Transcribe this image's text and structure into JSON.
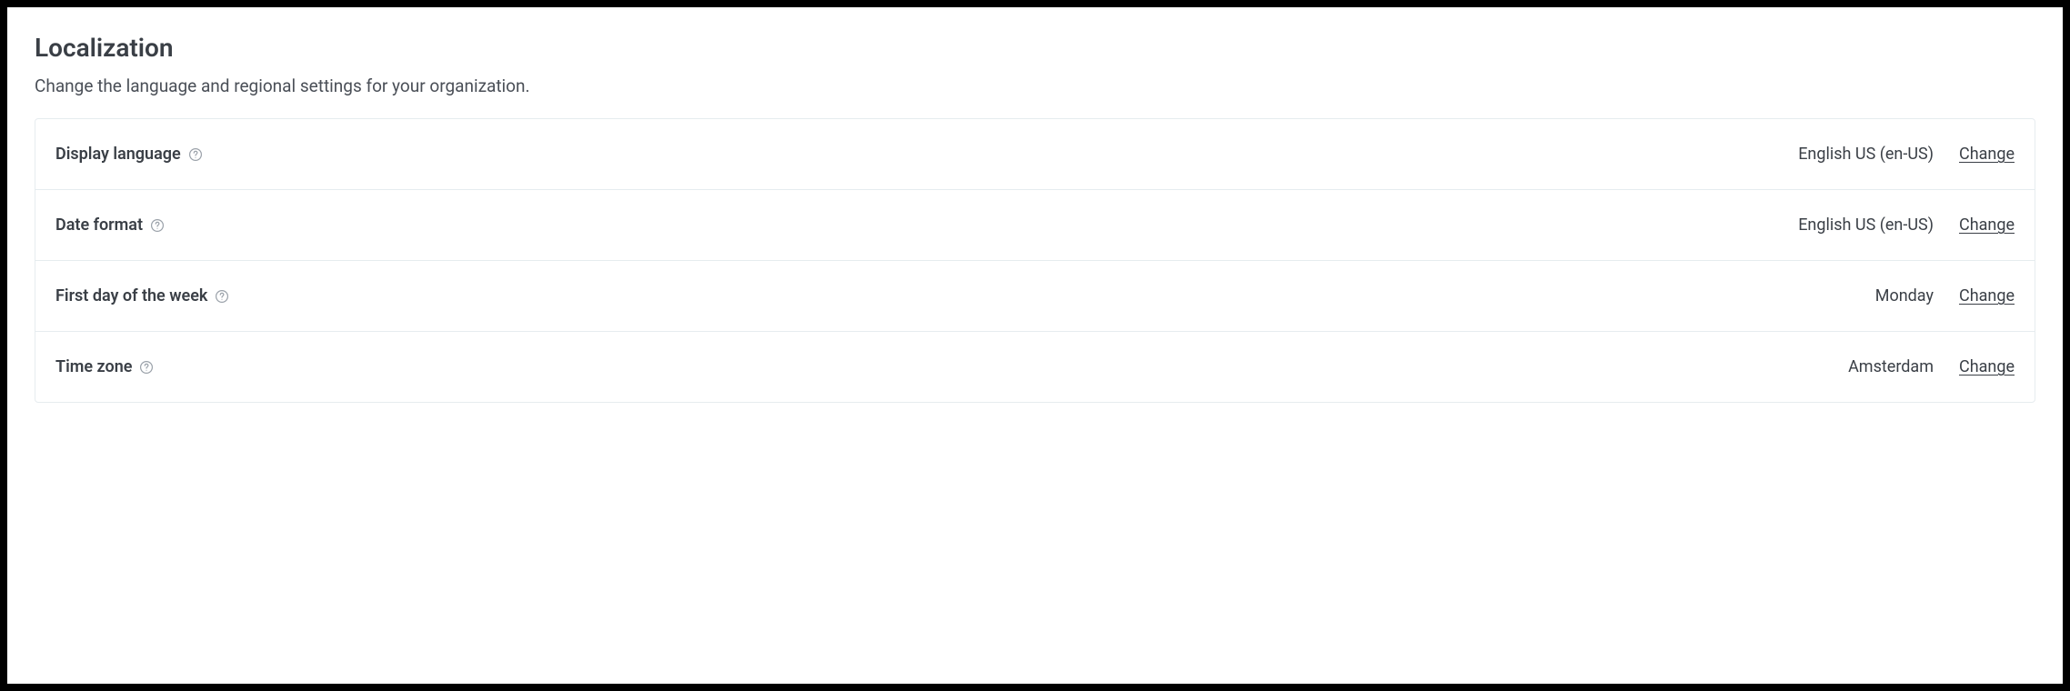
{
  "header": {
    "title": "Localization",
    "subtitle": "Change the language and regional settings for your organization."
  },
  "settings": [
    {
      "key": "display-language",
      "label": "Display language",
      "value": "English US (en-US)",
      "action": "Change"
    },
    {
      "key": "date-format",
      "label": "Date format",
      "value": "English US (en-US)",
      "action": "Change"
    },
    {
      "key": "first-day-of-week",
      "label": "First day of the week",
      "value": "Monday",
      "action": "Change"
    },
    {
      "key": "time-zone",
      "label": "Time zone",
      "value": "Amsterdam",
      "action": "Change"
    }
  ]
}
